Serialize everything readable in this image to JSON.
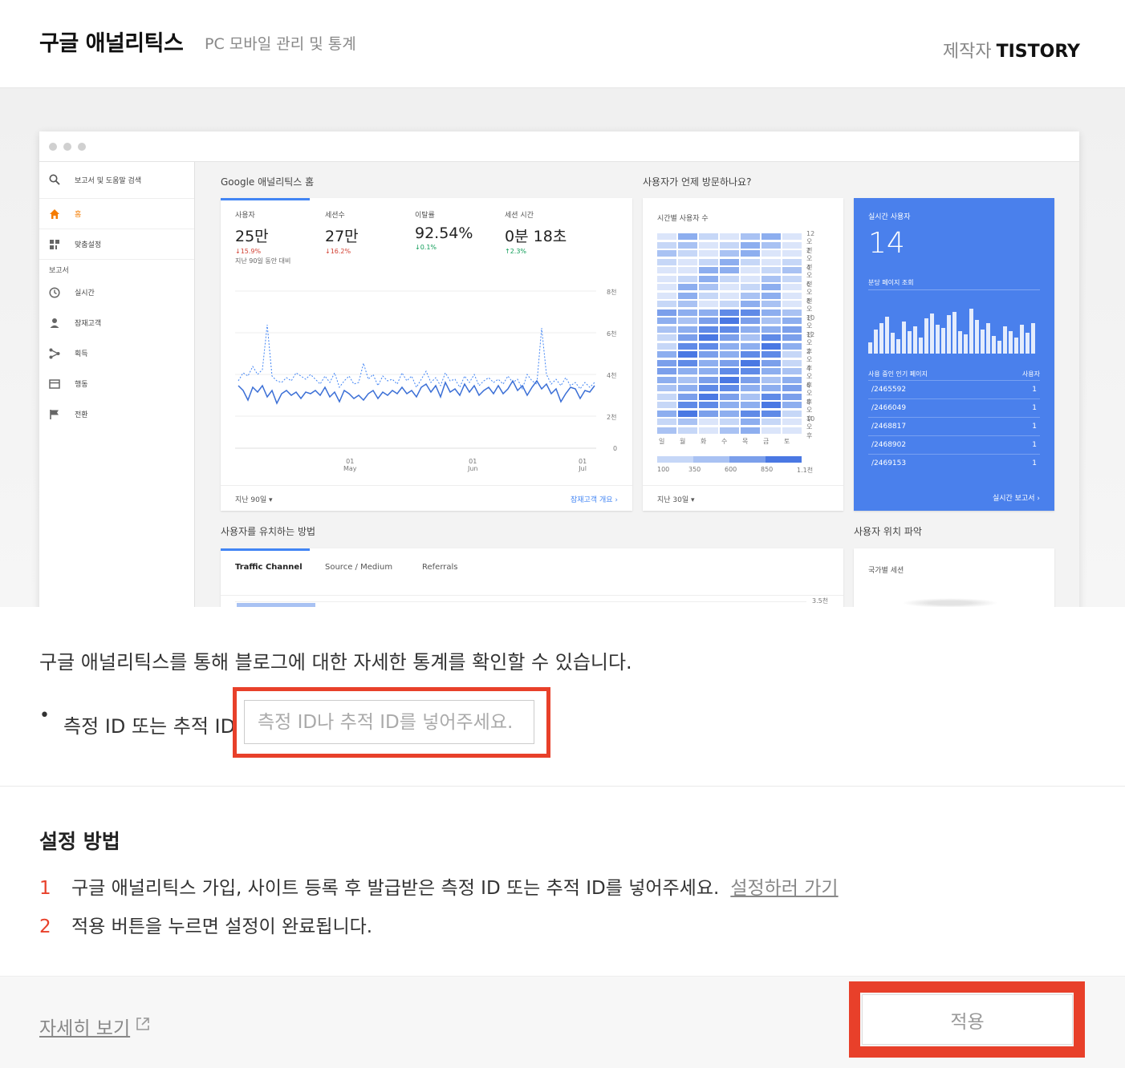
{
  "header": {
    "title": "구글 애널리틱스",
    "subtitle": "PC 모바일 관리 및 통계",
    "maker_label": "제작자",
    "maker_name": "TISTORY"
  },
  "preview": {
    "sidebar": {
      "search_label": "보고서 및 도움말 검색",
      "home": "홈",
      "customize": "맞춤설정",
      "reports_section": "보고서",
      "items": [
        "실시간",
        "잠재고객",
        "획득",
        "행동",
        "전환"
      ]
    },
    "home_title": "Google 애널리틱스 홈",
    "when_title": "사용자가 언제 방문하나요?",
    "acquire_title": "사용자를 유치하는 방법",
    "location_title": "사용자 위치 파악",
    "metrics": [
      {
        "label": "사용자",
        "value": "25만",
        "delta": "↓15.9%"
      },
      {
        "label": "세션수",
        "value": "27만",
        "delta": "↓16.2%"
      },
      {
        "label": "이탈률",
        "value": "92.54%",
        "delta": "↓0.1%"
      },
      {
        "label": "세션 시간",
        "value": "0분 18초",
        "delta": "↑2.3%"
      }
    ],
    "compare_note": "지난 90일 동안 대비",
    "y_ticks": [
      "8천",
      "6천",
      "4천",
      "2천",
      "0"
    ],
    "x_ticks": [
      {
        "day": "01",
        "month": "May"
      },
      {
        "day": "01",
        "month": "Jun"
      },
      {
        "day": "01",
        "month": "Jul"
      }
    ],
    "range_90": "지난 90일 ▾",
    "audience_link": "잠재고객 개요",
    "heatmap_title": "시간별 사용자 수",
    "heatmap_hours": [
      "12오전",
      "2오전",
      "4오전",
      "6오전",
      "8오전",
      "10오전",
      "12오후",
      "2오후",
      "4오후",
      "6오후",
      "8오후",
      "10오후"
    ],
    "heatmap_days": [
      "일",
      "월",
      "화",
      "수",
      "목",
      "금",
      "토"
    ],
    "heatmap_scale": [
      "100",
      "350",
      "600",
      "850",
      "1.1천"
    ],
    "range_30": "지난 30일 ▾",
    "realtime": {
      "title": "실시간 사용자",
      "value": "14",
      "pageviews_label": "분당 페이지 조회",
      "pages_header": "사용 중인 인기 페이지",
      "users_header": "사용자",
      "pages": [
        {
          "path": "/2465592",
          "users": "1"
        },
        {
          "path": "/2466049",
          "users": "1"
        },
        {
          "path": "/2468817",
          "users": "1"
        },
        {
          "path": "/2468902",
          "users": "1"
        },
        {
          "path": "/2469153",
          "users": "1"
        }
      ],
      "report_link": "실시간 보고서"
    },
    "tabs": [
      "Traffic Channel",
      "Source / Medium",
      "Referrals"
    ],
    "tab_axis": "3.5천",
    "geo_title": "국가별 세션"
  },
  "description": "구글 애널리틱스를 통해 블로그에 대한 자세한 통계를 확인할 수 있습니다.",
  "field": {
    "bullet": "•",
    "label": "측정 ID 또는 추적 ID",
    "placeholder": "측정 ID나 추적 ID를 넣어주세요.",
    "value": ""
  },
  "setup": {
    "title": "설정 방법",
    "steps": [
      {
        "num": "1",
        "text": "구글 애널리틱스 가입, 사이트 등록 후 발급받은 측정 ID 또는 추적 ID를 넣어주세요.",
        "link": "설정하러 가기"
      },
      {
        "num": "2",
        "text": "적용 버튼을 누르면 설정이 완료됩니다."
      }
    ]
  },
  "footer": {
    "more_link": "자세히 보기",
    "apply_button": "적용"
  },
  "colors": {
    "highlight": "#e8402a",
    "ga_blue": "#4a80ec",
    "step_number": "#e8402a"
  }
}
